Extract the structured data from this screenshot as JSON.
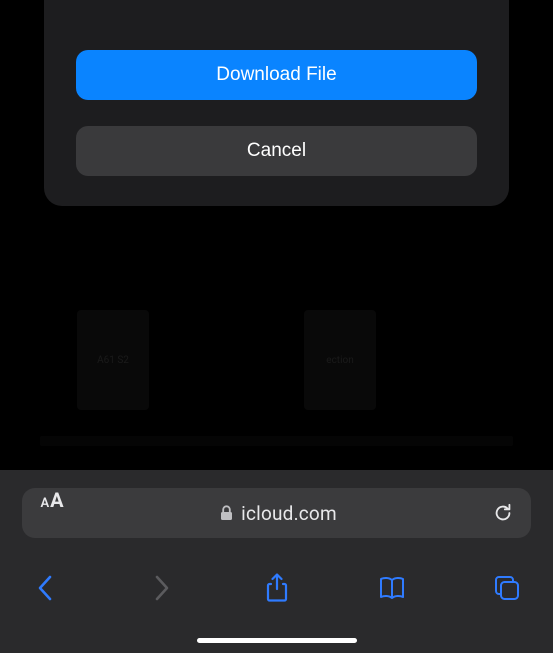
{
  "colors": {
    "accent": "#0a84ff",
    "nav": "#2f7bff"
  },
  "dialog": {
    "download_label": "Download File",
    "cancel_label": "Cancel"
  },
  "background": {
    "tile1_text": "A61 S2",
    "tile2_text": "ection"
  },
  "address_bar": {
    "format_label_small": "A",
    "format_label_big": "A",
    "domain": "icloud.com"
  }
}
